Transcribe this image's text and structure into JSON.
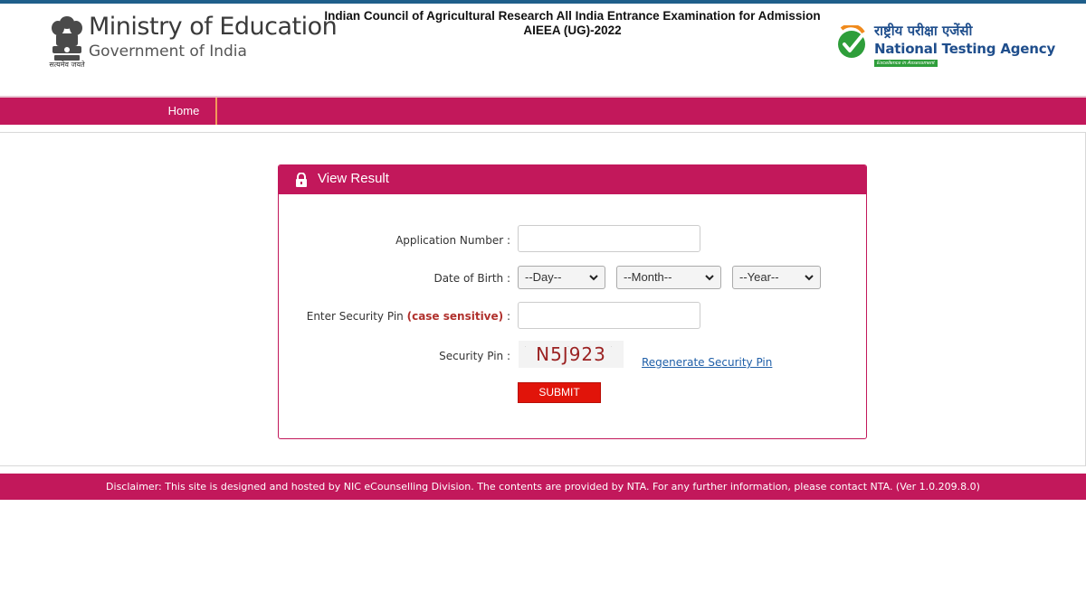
{
  "header": {
    "ministry_title": "Ministry of Education",
    "ministry_subtitle": "Government of India",
    "emblem_caption": "सत्यमेव जयते",
    "exam_title_line1": "Indian Council of Agricultural Research All India Entrance Examination for Admission",
    "exam_title_line2": "AIEEA (UG)-2022",
    "nta_hindi": "राष्ट्रीय परीक्षा एजेंसी",
    "nta_english": "National Testing Agency",
    "nta_tagline": "Excellence in Assessment"
  },
  "nav": {
    "home_label": "Home"
  },
  "panel": {
    "title": "View Result",
    "application_number_label": "Application Number :",
    "application_number_value": "",
    "dob_label": "Date of Birth :",
    "day_selected": "--Day--",
    "month_selected": "--Month--",
    "year_selected": "--Year--",
    "security_pin_input_label": "Enter Security Pin",
    "security_pin_input_warning": "(case sensitive)",
    "security_pin_input_colon": ":",
    "security_pin_input_value": "",
    "security_pin_label": "Security Pin :",
    "captcha_text": "N5J923",
    "regenerate_label": "Regenerate Security Pin",
    "submit_label": "SUBMIT"
  },
  "footer": {
    "disclaimer": "Disclaimer: This site is designed and hosted by NIC eCounselling Division. The contents are provided by NTA. For any further information, please contact NTA. (Ver 1.0.209.8.0)"
  },
  "colors": {
    "brand_magenta": "#c2185b",
    "submit_red": "#e1140a",
    "link_blue": "#1f5fa8",
    "nta_blue": "#1f4e8c",
    "nta_green": "#2e9e3a",
    "nav_divider_orange": "#f29a5a"
  },
  "icons": {
    "emblem": "national-emblem-icon",
    "nta_logo": "nta-checkmark-icon",
    "panel_lock": "lock-icon",
    "select_chevron": "chevron-down-icon"
  }
}
